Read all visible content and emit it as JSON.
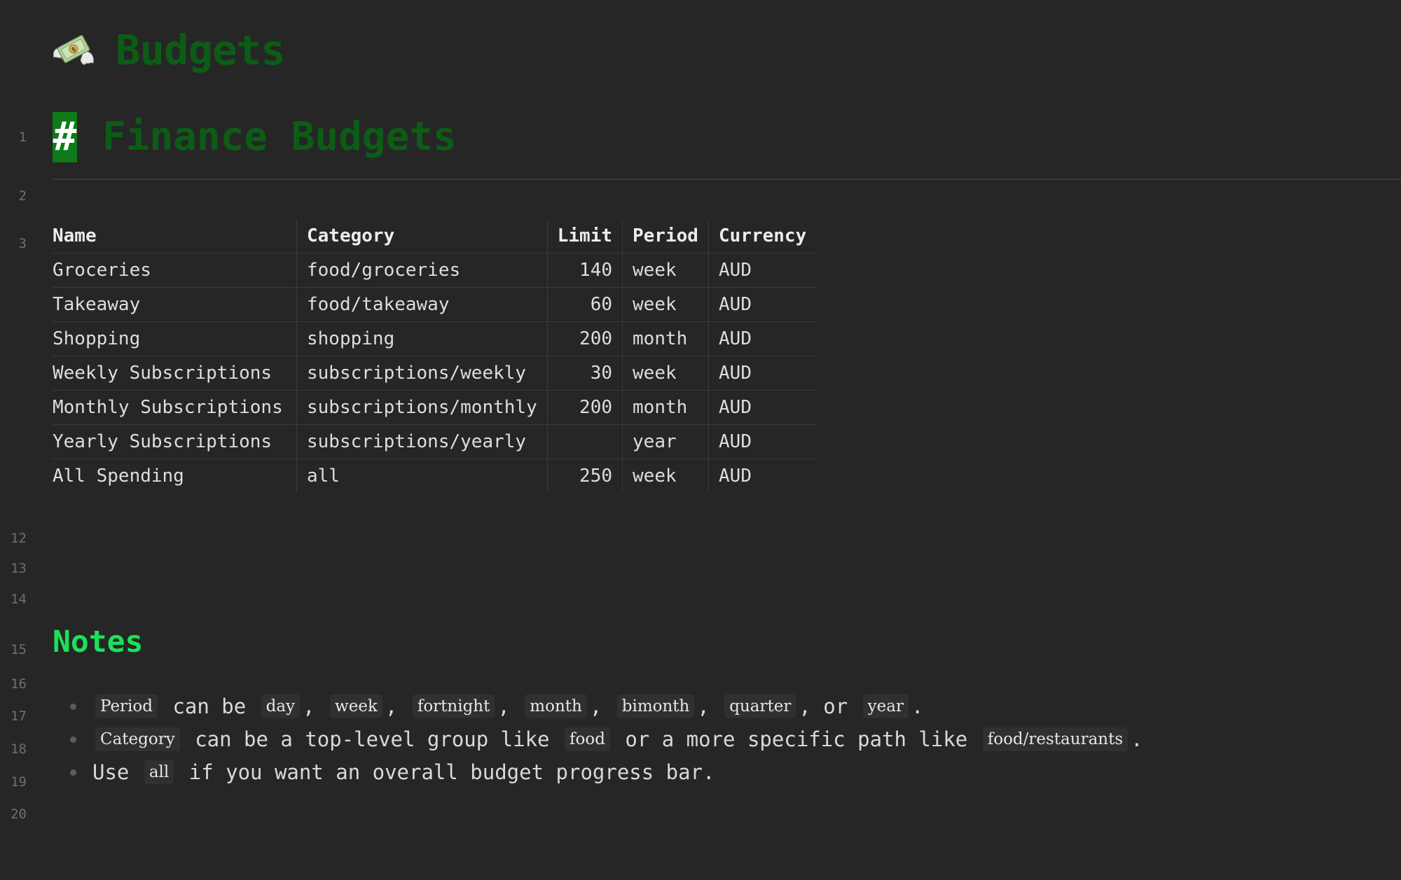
{
  "page": {
    "icon": "money-with-wings-icon",
    "title": "Budgets"
  },
  "gutter": [
    "1",
    "2",
    "3",
    "12",
    "13",
    "14",
    "15",
    "16",
    "17",
    "18",
    "19",
    "20"
  ],
  "heading1": {
    "marker": "#",
    "text": "Finance Budgets"
  },
  "table": {
    "headers": [
      "Name",
      "Category",
      "Limit",
      "Period",
      "Currency"
    ],
    "rows": [
      {
        "name": "Groceries",
        "category": "food/groceries",
        "limit": "140",
        "period": "week",
        "currency": "AUD"
      },
      {
        "name": "Takeaway",
        "category": "food/takeaway",
        "limit": "60",
        "period": "week",
        "currency": "AUD"
      },
      {
        "name": "Shopping",
        "category": "shopping",
        "limit": "200",
        "period": "month",
        "currency": "AUD"
      },
      {
        "name": "Weekly Subscriptions",
        "category": "subscriptions/weekly",
        "limit": "30",
        "period": "week",
        "currency": "AUD"
      },
      {
        "name": "Monthly Subscriptions",
        "category": "subscriptions/monthly",
        "limit": "200",
        "period": "month",
        "currency": "AUD"
      },
      {
        "name": "Yearly Subscriptions",
        "category": "subscriptions/yearly",
        "limit": "",
        "period": "year",
        "currency": "AUD"
      },
      {
        "name": "All Spending",
        "category": "all",
        "limit": "250",
        "period": "week",
        "currency": "AUD"
      }
    ]
  },
  "notes": {
    "heading": "Notes",
    "items": [
      {
        "parts": [
          {
            "code": "Period"
          },
          {
            "text": " can be "
          },
          {
            "code": "day"
          },
          {
            "text": ", "
          },
          {
            "code": "week"
          },
          {
            "text": ", "
          },
          {
            "code": "fortnight"
          },
          {
            "text": ", "
          },
          {
            "code": "month"
          },
          {
            "text": ", "
          },
          {
            "code": "bimonth"
          },
          {
            "text": ", "
          },
          {
            "code": "quarter"
          },
          {
            "text": ", or "
          },
          {
            "code": "year"
          },
          {
            "text": "."
          }
        ]
      },
      {
        "parts": [
          {
            "code": "Category"
          },
          {
            "text": " can be a top-level group like "
          },
          {
            "code": "food"
          },
          {
            "text": " or a more specific path like "
          },
          {
            "code": "food/restaurants"
          },
          {
            "text": "."
          }
        ]
      },
      {
        "parts": [
          {
            "text": "Use "
          },
          {
            "code": "all"
          },
          {
            "text": " if you want an overall budget progress bar."
          }
        ]
      }
    ]
  },
  "colors": {
    "background": "#262626",
    "title_green": "#0c5c16",
    "hash_bg": "#0f7a19",
    "notes_green": "#19e25a"
  }
}
